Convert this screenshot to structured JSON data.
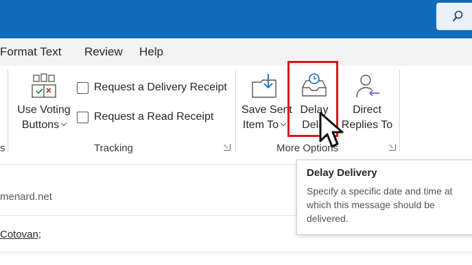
{
  "search": {
    "icon": "search-icon"
  },
  "tabs": [
    {
      "label": "Format Text"
    },
    {
      "label": "Review"
    },
    {
      "label": "Help"
    }
  ],
  "ribbon": {
    "voting": {
      "line1": "Use Voting",
      "line2": "Buttons"
    },
    "checks": [
      {
        "label": "Request a Delivery Receipt",
        "checked": false
      },
      {
        "label": "Request a Read Receipt",
        "checked": false
      }
    ],
    "tracking_label": "Tracking",
    "left_group_fragment": "s",
    "save_sent": {
      "line1": "Save Sent",
      "line2": "Item To"
    },
    "delay": {
      "line1": "Delay",
      "line2": "Deliv"
    },
    "direct": {
      "line1": "Direct",
      "line2": "Replies To"
    },
    "more_options_label": "More Options"
  },
  "compose": {
    "from_fragment": "menard.net",
    "cc_fragment": "Cotovan;"
  },
  "tooltip": {
    "title": "Delay Delivery",
    "lines": [
      "Specify a specific date and time at",
      "which this message should be",
      "delivered."
    ]
  },
  "colors": {
    "titlebar": "#0f6cbd",
    "highlight": "#d8141c"
  }
}
